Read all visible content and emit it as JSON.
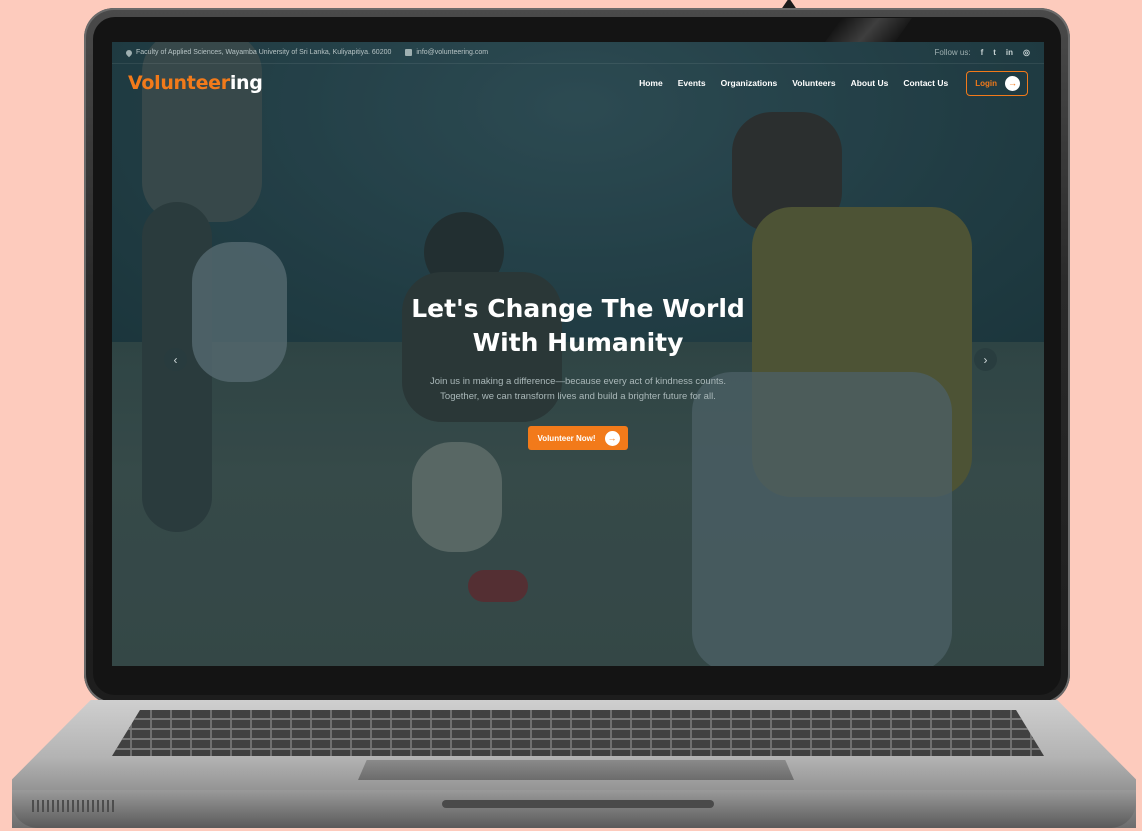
{
  "topbar": {
    "address": "Faculty of Applied Sciences, Wayamba University of Sri Lanka, Kuliyapitiya. 60200",
    "email": "info@volunteering.com",
    "follow_label": "Follow us:",
    "social_icons": [
      "facebook-icon",
      "twitter-icon",
      "linkedin-icon",
      "instagram-icon"
    ],
    "social_glyphs": [
      "f",
      "t",
      "in",
      "◎"
    ]
  },
  "brand": {
    "logo_primary": "Volunteer",
    "logo_secondary": "ing"
  },
  "nav": {
    "items": [
      "Home",
      "Events",
      "Organizations",
      "Volunteers",
      "About Us",
      "Contact Us"
    ],
    "login_label": "Login"
  },
  "hero": {
    "title_line1": "Let's Change The World",
    "title_line2": "With Humanity",
    "text_line1": "Join us in making a difference—because every act of kindness counts.",
    "text_line2": "Together, we can transform lives and build a brighter future for all.",
    "cta_label": "Volunteer Now!"
  },
  "carousel": {
    "prev_glyph": "‹",
    "next_glyph": "›",
    "arrow_glyph": "→"
  },
  "colors": {
    "accent": "#f27a1a",
    "background": "#fdcbbd"
  }
}
